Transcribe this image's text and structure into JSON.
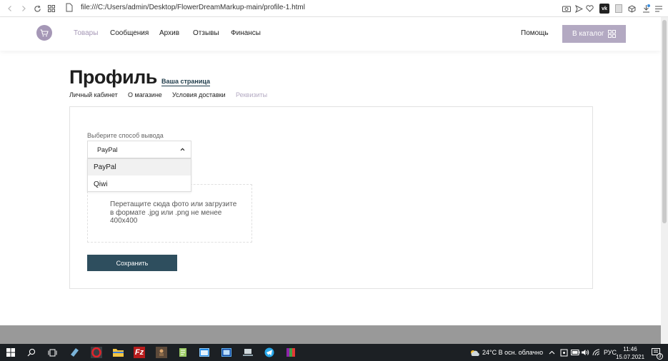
{
  "browser": {
    "url": "file:///C:/Users/admin/Desktop/FlowerDreamMarkup-main/profile-1.html"
  },
  "header": {
    "nav": [
      "Товары",
      "Сообщения",
      "Архив",
      "Отзывы",
      "Финансы"
    ],
    "active_nav": "Товары",
    "help": "Помощь",
    "catalog_button": "В каталог"
  },
  "profile": {
    "title": "Профиль",
    "your_page_link": "Ваша страница",
    "tabs": [
      "Личный кабинет",
      "О магазине",
      "Условия доставки",
      "Реквизиты"
    ],
    "active_tab": "Реквизиты"
  },
  "form": {
    "withdraw_label": "Выберите способ вывода",
    "selected_method": "PayPal",
    "options": [
      "PayPal",
      "Qiwi"
    ],
    "upload_text": "Перетащите сюда фото или загрузите в формате .jpg или .png не менее 400х400",
    "save_button": "Сохранить"
  },
  "taskbar": {
    "weather": "24°C  В осн. облачно",
    "language": "РУС",
    "time": "11:46",
    "date": "15.07.2021",
    "notifications": "3"
  },
  "colors": {
    "accent": "#a597b6",
    "catalog_button": "#b3a9c2",
    "save_button": "#2e4e5e",
    "footer": "#999999",
    "taskbar": "#1c2024"
  }
}
